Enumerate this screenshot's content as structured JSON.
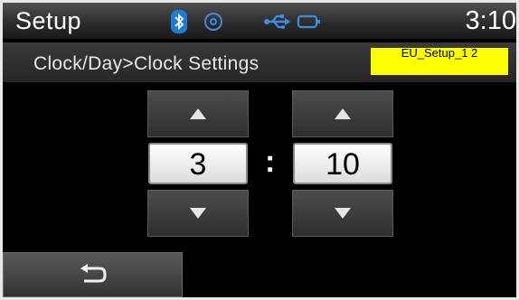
{
  "header": {
    "title": "Setup",
    "time": "3:10",
    "icons": [
      "bluetooth-icon",
      "disc-icon",
      "usb-icon",
      "ipod-icon"
    ]
  },
  "subheader": {
    "breadcrumb": "Clock/Day>Clock Settings",
    "tag": "EU_Setup_1 2"
  },
  "clock_settings": {
    "hour": "3",
    "separator": ":",
    "minute": "10"
  },
  "footer": {
    "back_icon": "back-arrow-icon"
  },
  "colors": {
    "tag_background": "#ffff00",
    "background": "#000000",
    "frame": "#e8e8e8"
  }
}
